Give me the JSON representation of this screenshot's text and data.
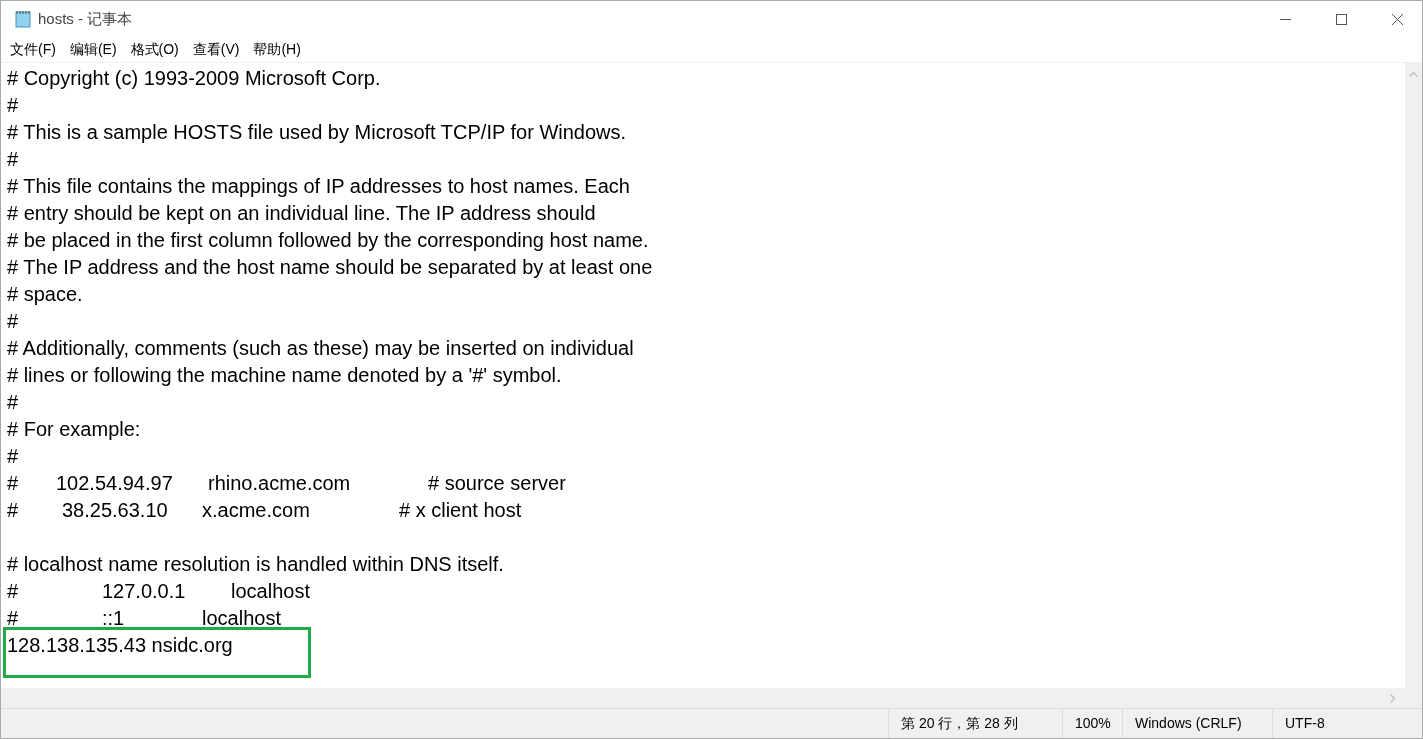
{
  "window": {
    "title": "hosts - 记事本"
  },
  "menu": [
    {
      "label": "文件(F)"
    },
    {
      "label": "编辑(E)"
    },
    {
      "label": "格式(O)"
    },
    {
      "label": "查看(V)"
    },
    {
      "label": "帮助(H)"
    }
  ],
  "editor": {
    "lines": [
      {
        "kind": "text",
        "segments": [
          "# Copyright (c) 1993-2009 Microsoft Corp."
        ]
      },
      {
        "kind": "text",
        "segments": [
          "#"
        ]
      },
      {
        "kind": "text",
        "segments": [
          "# This is a sample HOSTS file used by Microsoft TCP/IP for Windows."
        ]
      },
      {
        "kind": "text",
        "segments": [
          "#"
        ]
      },
      {
        "kind": "text",
        "segments": [
          "# This file contains the mappings of IP addresses to host names. Each"
        ]
      },
      {
        "kind": "text",
        "segments": [
          "# entry should be kept on an individual line. The IP address should"
        ]
      },
      {
        "kind": "text",
        "segments": [
          "# be placed in the first column followed by the corresponding host name."
        ]
      },
      {
        "kind": "text",
        "segments": [
          "# The IP address and the host name should be separated by at least one"
        ]
      },
      {
        "kind": "text",
        "segments": [
          "# space."
        ]
      },
      {
        "kind": "text",
        "segments": [
          "#"
        ]
      },
      {
        "kind": "text",
        "segments": [
          "# Additionally, comments (such as these) may be inserted on individual"
        ]
      },
      {
        "kind": "text",
        "segments": [
          "# lines or following the machine name denoted by a '#' symbol."
        ]
      },
      {
        "kind": "text",
        "segments": [
          "#"
        ]
      },
      {
        "kind": "text",
        "segments": [
          "# For example:"
        ]
      },
      {
        "kind": "text",
        "segments": [
          "#"
        ]
      },
      {
        "kind": "text",
        "segments": [
          "#",
          "102.54.94.97",
          "rhino.acme.com",
          "# source server"
        ]
      },
      {
        "kind": "text",
        "segments": [
          "#",
          "38.25.63.10",
          "x.acme.com",
          "# x client host"
        ]
      },
      {
        "kind": "blank"
      },
      {
        "kind": "text",
        "segments": [
          "# localhost name resolution is handled within DNS itself."
        ]
      },
      {
        "kind": "text",
        "segments": [
          "#",
          "127.0.0.1",
          "localhost"
        ]
      },
      {
        "kind": "text",
        "segments": [
          "#",
          "::1",
          "localhost"
        ]
      },
      {
        "kind": "text",
        "segments": [
          "128.138.135.43 nsidc.org"
        ],
        "highlighted": true
      }
    ]
  },
  "status_bar": [
    {
      "text": "第 20 行，第 28 列"
    },
    {
      "text": "100%"
    },
    {
      "text": "Windows (CRLF)"
    },
    {
      "text": "UTF-8"
    }
  ]
}
